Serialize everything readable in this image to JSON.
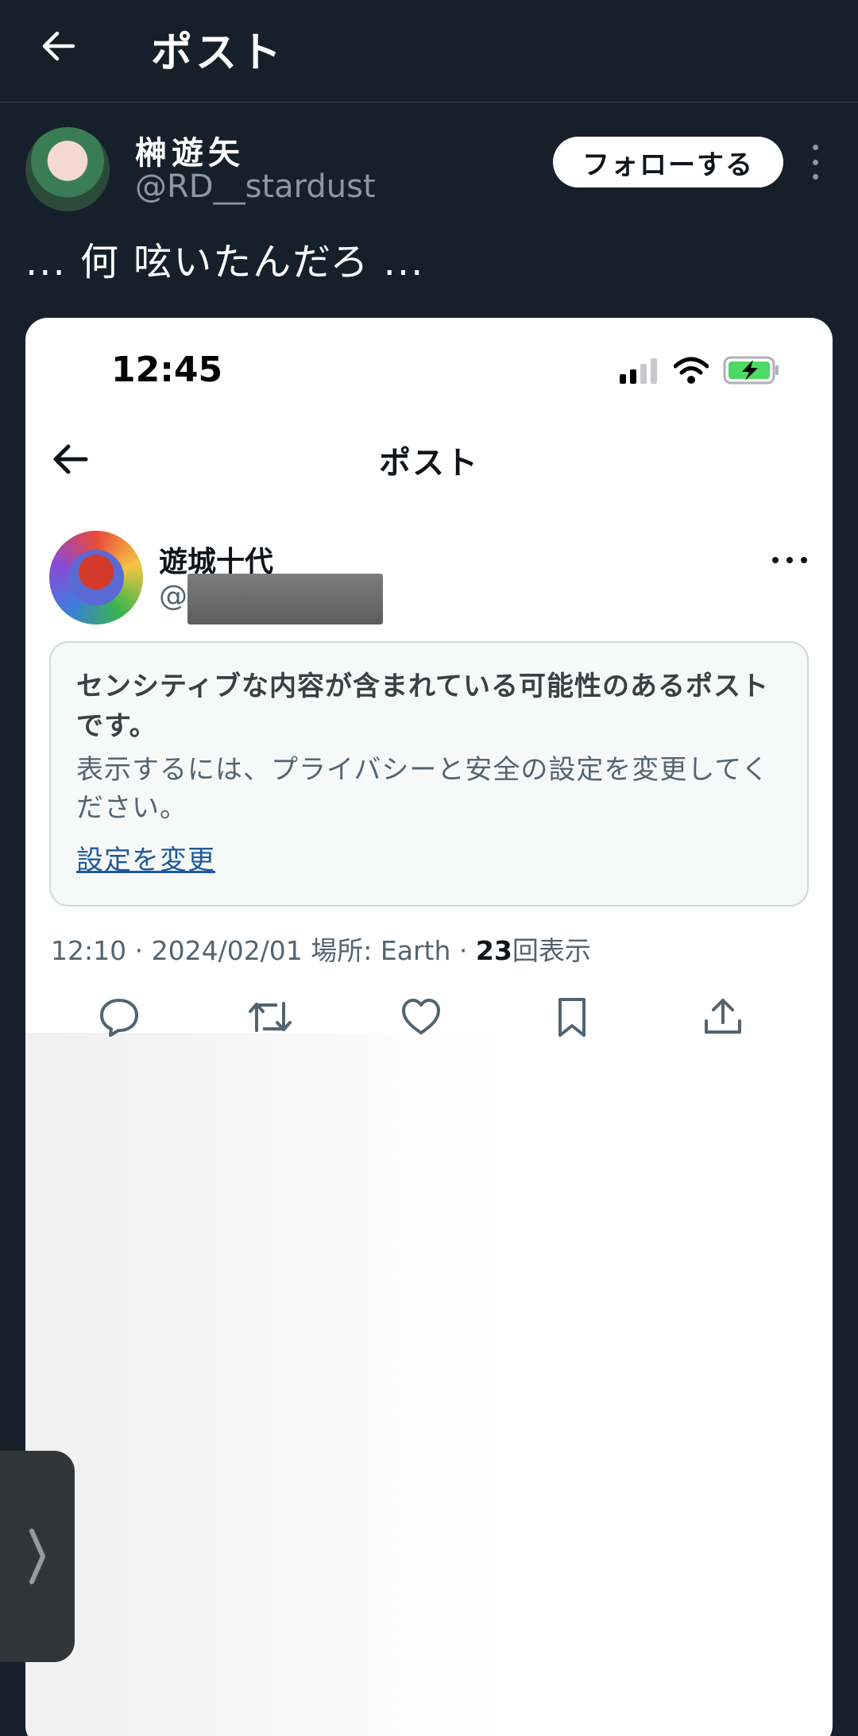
{
  "appbar": {
    "title": "ポスト"
  },
  "author": {
    "name": "榊遊矢",
    "handle": "@RD__stardust",
    "follow_label": "フォローする"
  },
  "post": {
    "text": "... 何 呟いたんだろ ..."
  },
  "embedded": {
    "status_time": "12:45",
    "title": "ポスト",
    "user": {
      "name": "遊城十代",
      "handle_prefix": "@"
    },
    "warning": {
      "title": "センシティブな内容が含まれている可能性のあるポストです。",
      "body": "表示するには、プライバシーと安全の設定を変更してください。",
      "link": "設定を変更"
    },
    "meta": {
      "time": "12:10",
      "sep1": " · ",
      "date": "2024/02/01",
      "location": " 場所: Earth",
      "sep2": " · ",
      "views": "23",
      "views_label": "回表示"
    }
  },
  "colors": {
    "background": "#15202b",
    "accent_link": "#1d5a9b",
    "secondary_text": "#8b98a5",
    "battery_green": "#4cd964"
  }
}
